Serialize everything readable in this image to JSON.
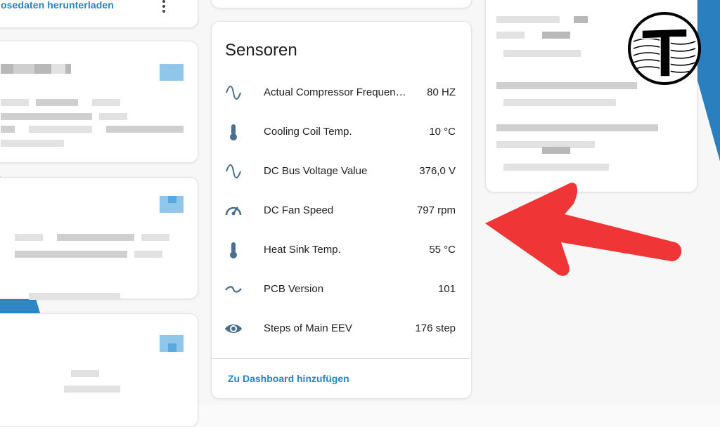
{
  "top_card": {
    "link_label": "osedaten herunterladen"
  },
  "sensor_card": {
    "title": "Sensoren",
    "rows": [
      {
        "icon": "sine-wave-icon",
        "label": "Actual Compressor Frequen…",
        "value": "80 HZ"
      },
      {
        "icon": "thermometer-icon",
        "label": "Cooling Coil Temp.",
        "value": "10 °C"
      },
      {
        "icon": "sine-wave-icon",
        "label": "DC Bus Voltage Value",
        "value": "376,0 V"
      },
      {
        "icon": "gauge-icon",
        "label": "DC Fan Speed",
        "value": "797 rpm"
      },
      {
        "icon": "thermometer-icon",
        "label": "Heat Sink Temp.",
        "value": "55 °C"
      },
      {
        "icon": "tilde-wave-icon",
        "label": "PCB Version",
        "value": "101"
      },
      {
        "icon": "eye-icon",
        "label": "Steps of Main EEV",
        "value": "176 step"
      }
    ],
    "add_link": "Zu Dashboard hinzufügen"
  },
  "logo": {
    "letter": "T"
  },
  "colors": {
    "accent": "#2a83c0",
    "icon": "#4a6f8a",
    "arrow": "#ef3535",
    "brand_blue": "#2f86c4"
  }
}
